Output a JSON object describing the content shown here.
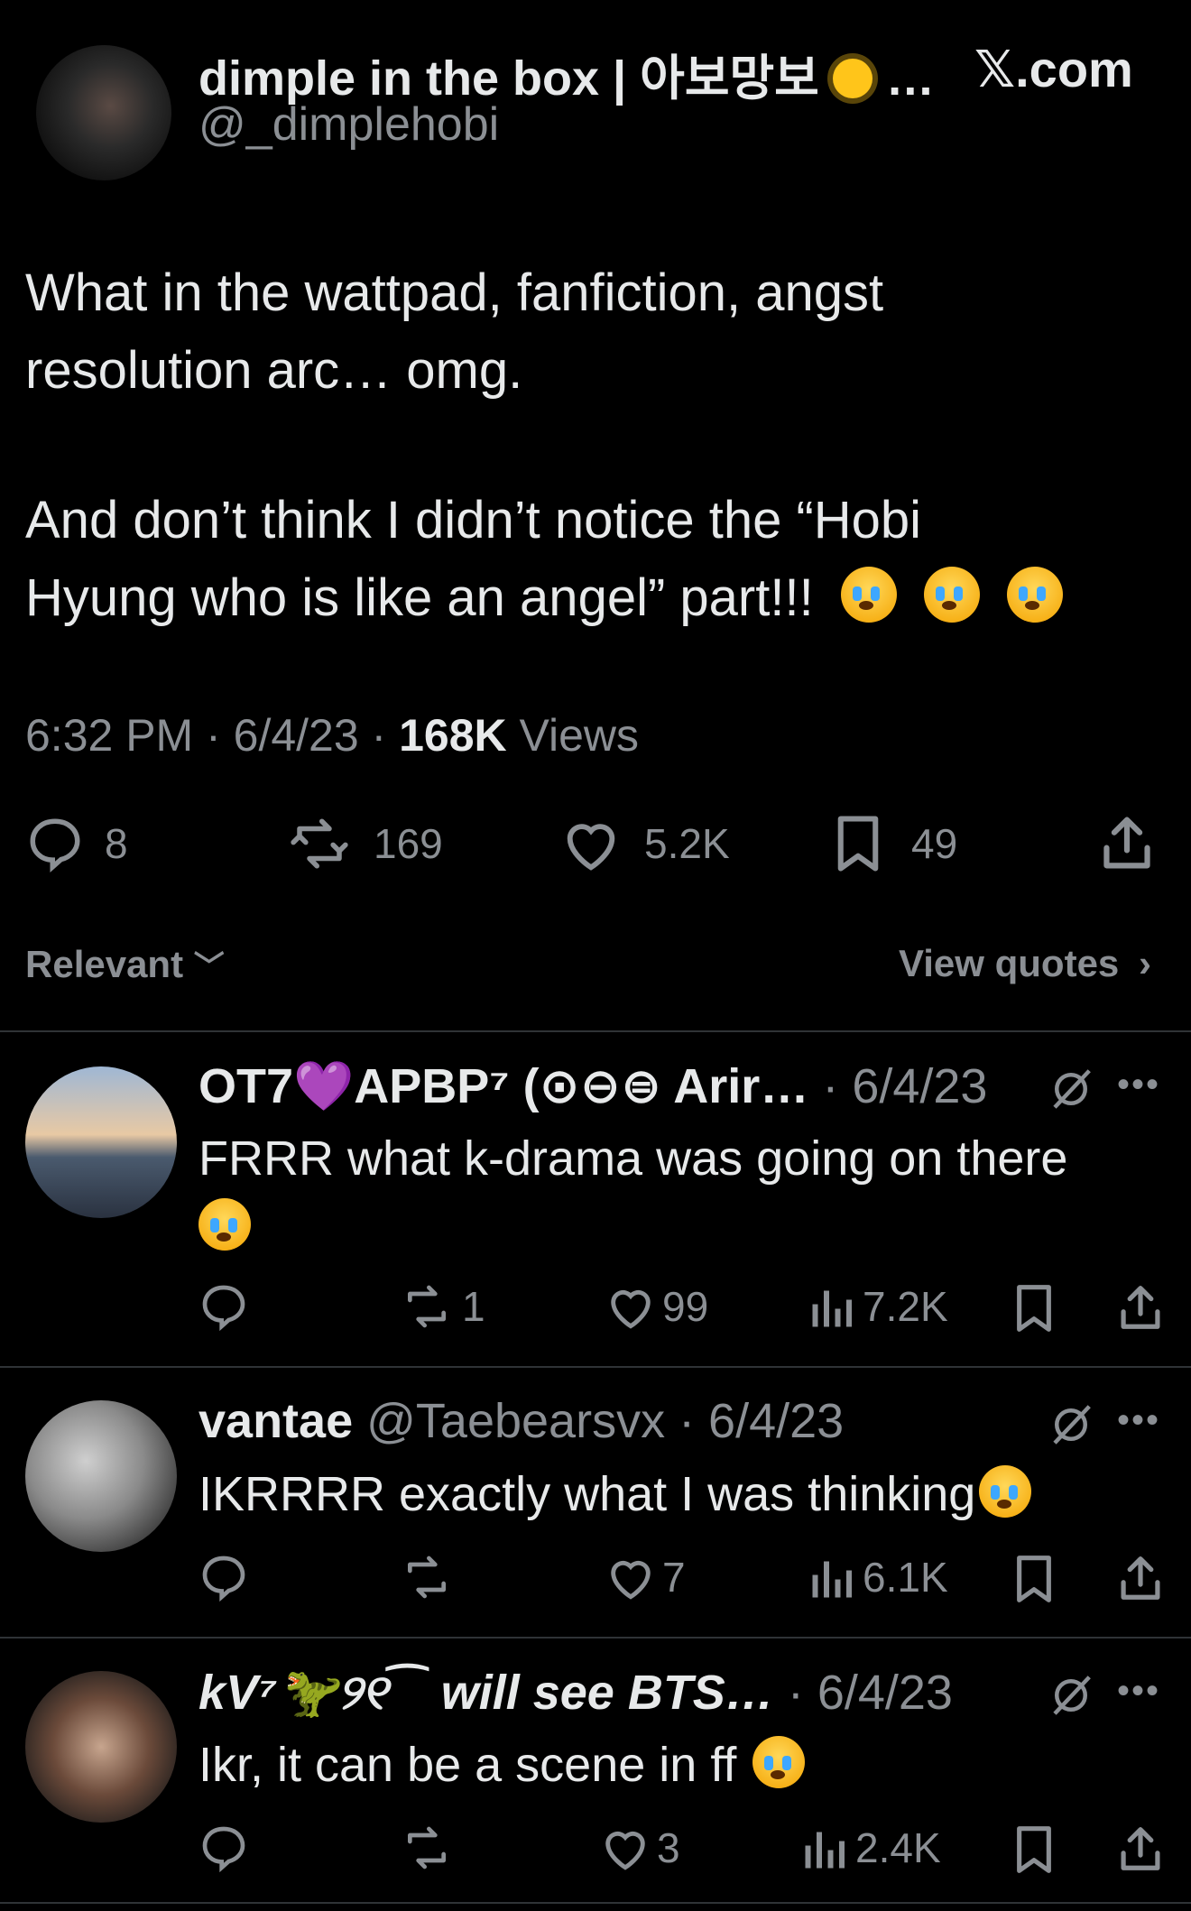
{
  "header": {
    "display_name": "dimple in the box | 아보망보",
    "name_suffix": "…",
    "handle": "@_dimplehobi",
    "source": "𝕏.com"
  },
  "tweet": {
    "paragraph1_line1": "What in the wattpad, fanfiction, angst",
    "paragraph1_line2": "resolution arc… omg.",
    "paragraph2_line1": "And don’t think I didn’t notice the “Hobi",
    "paragraph2_line2": "Hyung who is like an angel” part!!!",
    "time": "6:32 PM · 6/4/23 · ",
    "views_count": "168K",
    "views_label": " Views",
    "stats": {
      "replies": "8",
      "reposts": "169",
      "likes": "5.2K",
      "bookmarks": "49"
    }
  },
  "sort": {
    "label": "Relevant",
    "view_quotes": "View quotes"
  },
  "replies": [
    {
      "name": "OT7💜APBP⁷ (⊙⊖⊜ Arir…",
      "meta": " · 6/4/23",
      "text_line1": "FRRR what k-drama was going on there",
      "reposts": "1",
      "likes": "99",
      "views": "7.2K"
    },
    {
      "name": "vantae",
      "meta": " @Taebearsvx · 6/4/23",
      "text_line1": "IKRRRR exactly what I was thinking",
      "reposts": "",
      "likes": "7",
      "views": "6.1K"
    },
    {
      "name": "kV⁷🦖୨୧⁀ will see BTS…",
      "meta": " · 6/4/23",
      "text_line1": "Ikr, it can be a scene in ff",
      "reposts": "",
      "likes": "3",
      "views": "2.4K"
    }
  ],
  "icons": {
    "reply": "reply-icon",
    "repost": "repost-icon",
    "like": "heart-icon",
    "bookmark": "bookmark-icon",
    "share": "share-icon",
    "views": "views-icon",
    "grok": "grok-icon",
    "more": "more-icon",
    "sun": "sun-emoji",
    "cry": "crying-emoji"
  },
  "colors": {
    "background": "#000000",
    "text": "#e7e9ea",
    "muted": "#8b8f94",
    "divider": "#2f3336",
    "heart_purple": "#a24dff"
  }
}
